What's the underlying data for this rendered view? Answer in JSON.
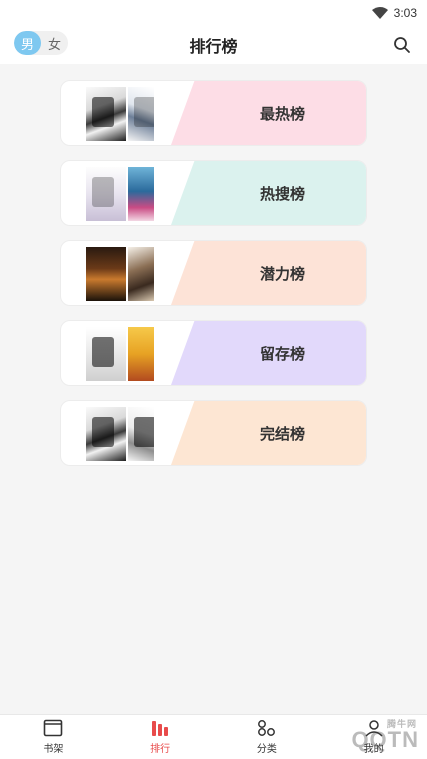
{
  "statusbar": {
    "time": "3:03"
  },
  "header": {
    "title": "排行榜",
    "gender": {
      "male": "男",
      "female": "女",
      "selected": "男"
    }
  },
  "rankings": [
    {
      "label": "最热榜",
      "color": "#fddde6"
    },
    {
      "label": "热搜榜",
      "color": "#dbf2ee"
    },
    {
      "label": "潜力榜",
      "color": "#fde3d7"
    },
    {
      "label": "留存榜",
      "color": "#e2d9fb"
    },
    {
      "label": "完结榜",
      "color": "#fde6d3"
    }
  ],
  "bottom_nav": [
    {
      "label": "书架",
      "icon": "bookshelf-icon"
    },
    {
      "label": "排行",
      "icon": "ranking-icon",
      "active": true
    },
    {
      "label": "分类",
      "icon": "category-icon"
    },
    {
      "label": "我的",
      "icon": "profile-icon"
    }
  ],
  "watermark": {
    "text": "QQTN",
    "small": "腾牛网"
  },
  "colors": {
    "accent": "#e84b4b",
    "toggle": "#7ec8f0"
  }
}
